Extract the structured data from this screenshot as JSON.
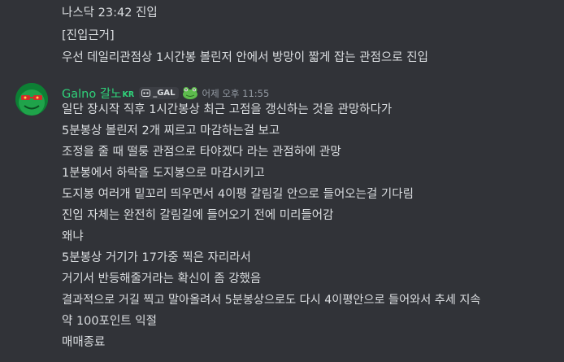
{
  "prev_message": {
    "lines": [
      "나스닥 23:42 진입",
      "[진입근거]",
      "우선 데일리관점상 1시간봉 볼린저 안에서 방망이 짧게 잡는 관점으로 진입"
    ]
  },
  "message": {
    "author": "Galno 갈노",
    "region": "KR",
    "guild_tag": "_GAL",
    "badge_emoji": "frog-emoji",
    "timestamp": "어제 오후 11:55",
    "lines": [
      "일단 장시작 직후 1시간봉상 최근 고점을 갱신하는 것을 관망하다가",
      "5분봉상 볼린저 2개 찌르고 마감하는걸 보고",
      "조정을 줄 때 떨룽 관점으로 타야겠다 라는 관점하에 관망",
      "1분봉에서 하락을 도지봉으로 마감시키고",
      "도지봉 여러개 밑꼬리 띄우면서 4이평 갈림길 안으로 들어오는걸 기다림",
      "진입 자체는 완전히 갈림길에 들어오기 전에 미리들어감",
      "왜냐",
      "5분봉상 거기가 17가중 찍은 자리라서",
      "거기서 반등해줄거라는 확신이 좀 강했음",
      "결과적으로 거길 찍고 말아올려서 5분봉상으로도 다시 4이평안으로 들어와서 추세 지속",
      "약 100포인트 익절",
      "매매종료"
    ]
  },
  "colors": {
    "background": "#313338",
    "text": "#dbdee1",
    "username": "#2fd37a",
    "timestamp": "#949ba4",
    "tag_bg": "#3c3e44"
  }
}
